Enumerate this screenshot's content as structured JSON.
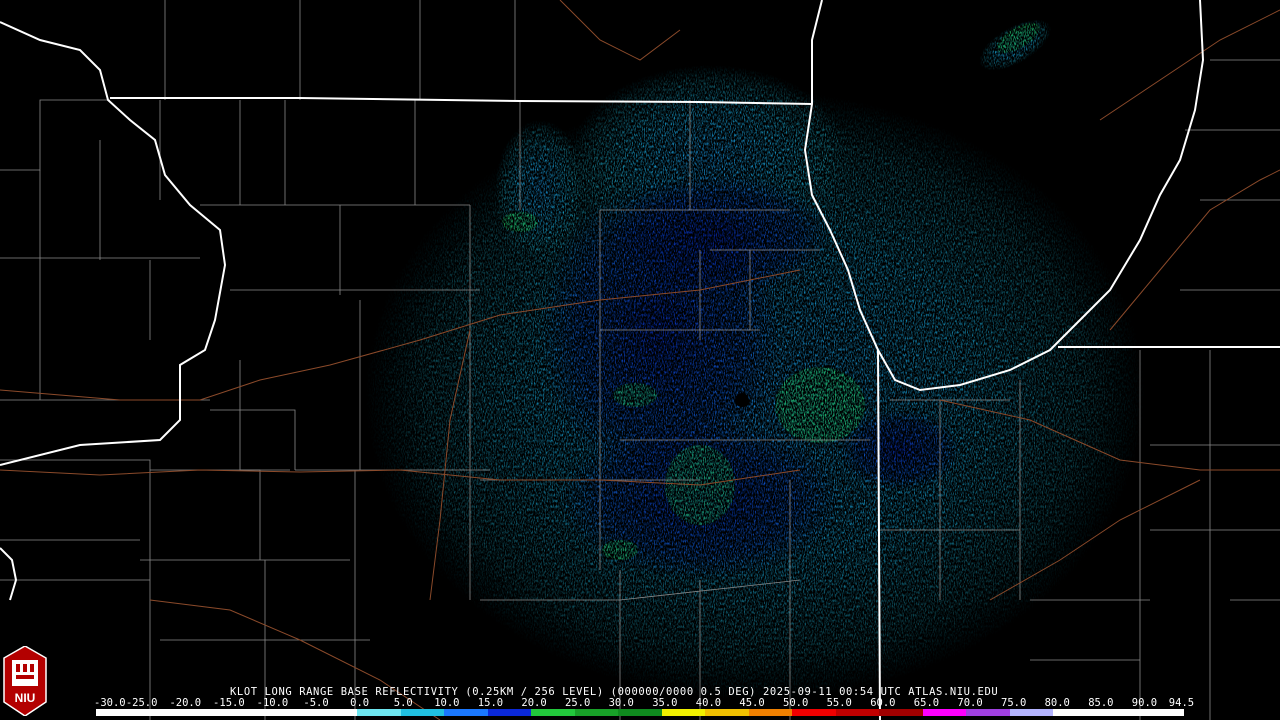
{
  "product_title": "KLOT LONG RANGE BASE REFLECTIVITY (0.25KM / 256 LEVEL) (000000/0000 0.5 DEG) 2025-09-11 00:54 UTC  ATLAS.NIU.EDU",
  "logo_text": "NIU",
  "scale_labels": [
    "-30.0",
    "-25.0",
    "-20.0",
    "-15.0",
    "-10.0",
    "-5.0",
    "0.0",
    "5.0",
    "10.0",
    "15.0",
    "20.0",
    "25.0",
    "30.0",
    "35.0",
    "40.0",
    "45.0",
    "50.0",
    "55.0",
    "60.0",
    "65.0",
    "70.0",
    "75.0",
    "80.0",
    "85.0",
    "90.0",
    "94.5"
  ],
  "colors": {
    "background": "#000000",
    "state_border": "#ffffff",
    "county_border": "#8a8a8a",
    "highway": "#8b4a2a",
    "reflectivity_light": "#1ec8e8",
    "reflectivity_medium": "#0a32e0",
    "reflectivity_strong": "#22c83c"
  }
}
